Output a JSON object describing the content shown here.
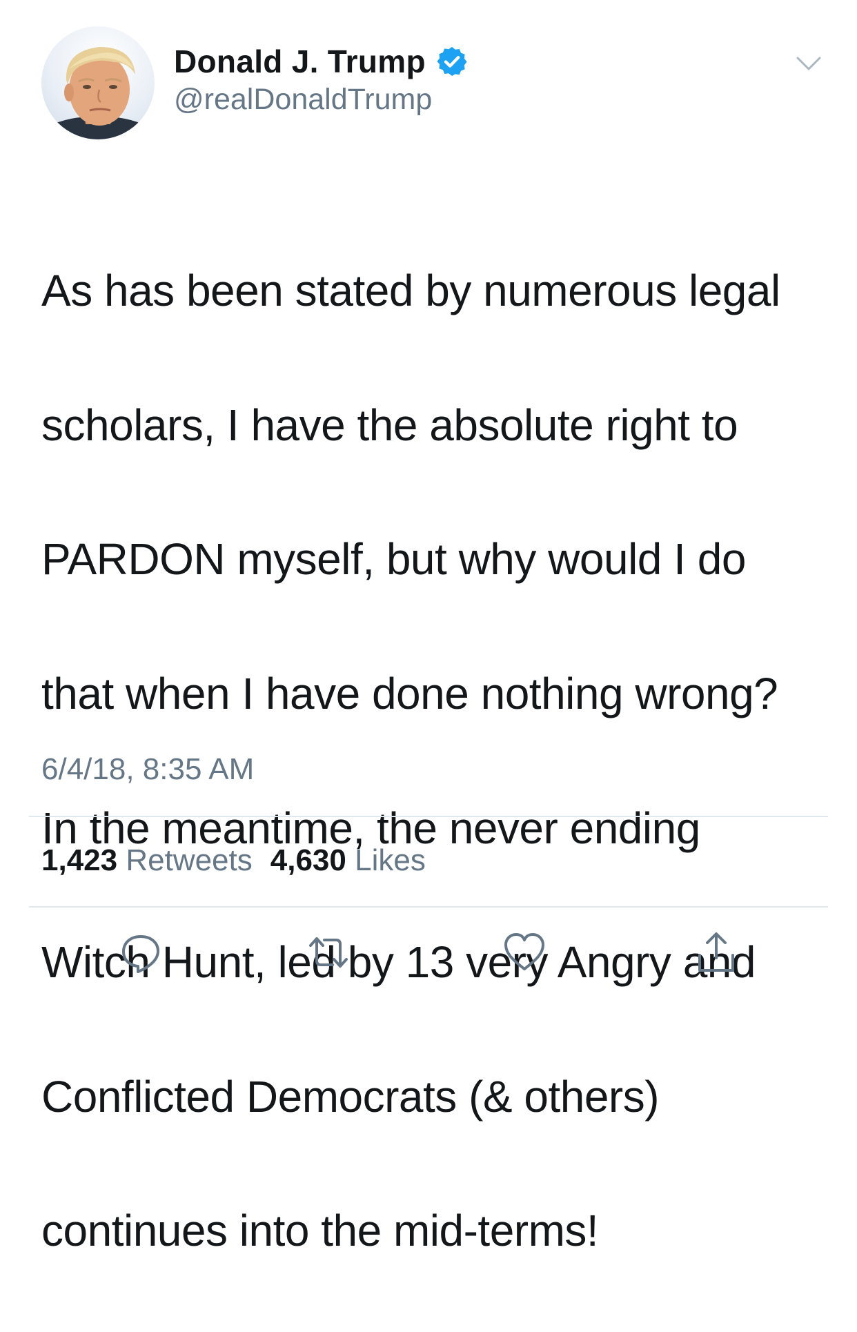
{
  "author": {
    "name": "Donald J. Trump",
    "handle": "@realDonaldTrump",
    "verified": true,
    "avatar_icon": "profile-photo",
    "verified_color": "#1da1f2"
  },
  "tweet": {
    "lines": [
      "As has been stated by numerous legal",
      "scholars, I have the absolute right to",
      "PARDON myself, but why would I do",
      "that when I have done nothing wrong?",
      "In the meantime, the never ending",
      "Witch Hunt, led by 13 very Angry and",
      "Conflicted Democrats (& others)",
      "continues into the mid-terms!"
    ],
    "timestamp": "6/4/18, 8:35 AM"
  },
  "stats": {
    "retweets_count": "1,423",
    "retweets_label": "Retweets",
    "likes_count": "4,630",
    "likes_label": "Likes"
  },
  "actions": [
    {
      "name": "reply",
      "icon": "reply-icon"
    },
    {
      "name": "retweet",
      "icon": "retweet-icon"
    },
    {
      "name": "like",
      "icon": "heart-icon"
    },
    {
      "name": "share",
      "icon": "share-icon"
    }
  ],
  "colors": {
    "text": "#14171a",
    "secondary": "#657786",
    "divider": "#e1e8ed",
    "accent": "#1da1f2"
  }
}
